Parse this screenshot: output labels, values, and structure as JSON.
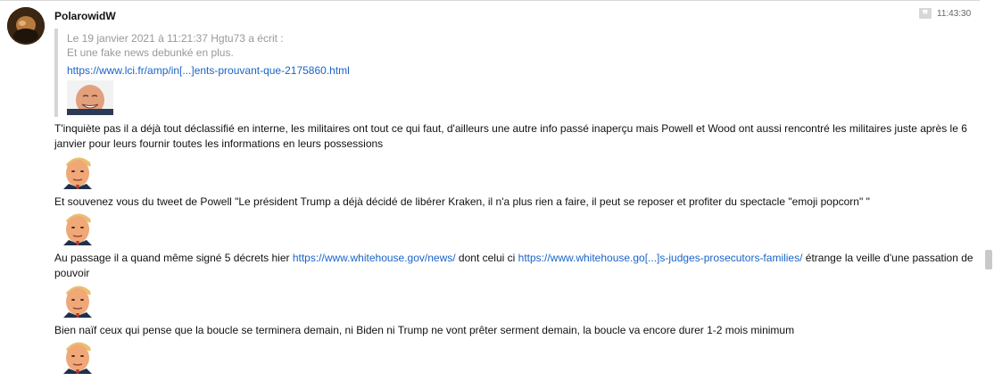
{
  "post": {
    "username": "PolarowidW",
    "timestamp": "11:43:30",
    "quote_icon": "quote-icon",
    "quote": {
      "header": "Le 19 janvier 2021 à 11:21:37 Hgtu73 a écrit :",
      "text": "Et une fake news debunké en plus.",
      "link": "https://www.lci.fr/amp/in[...]ents-prouvant-que-2175860.html",
      "image": "biden-laughing-sticker"
    },
    "paragraphs": {
      "p1": "T'inquiète pas il a déjà tout déclassifié en interne, les militaires ont tout ce qui faut, d'ailleurs une autre info passé inaperçu mais Powell et Wood ont aussi rencontré les militaires juste après le 6 janvier pour leurs fournir toutes les informations en leurs possessions",
      "p2": "Et souvenez vous du tweet de Powell \"Le président Trump a déjà décidé de libérer Kraken, il n'a plus rien a faire, il peut se reposer et profiter du spectacle \"emoji popcorn\" \"",
      "p3_before": "Au passage il a quand même signé 5 décrets hier ",
      "p3_link1": "https://www.whitehouse.gov/news/",
      "p3_mid": " dont celui ci ",
      "p3_link2": "https://www.whitehouse.go[...]s-judges-prosecutors-families/",
      "p3_after": " étrange la veille d'une passation de pouvoir",
      "p4": "Bien naïf ceux qui pense que la boucle se terminera demain, ni Biden ni Trump ne vont prêter serment demain, la boucle va encore durer 1-2 mois minimum"
    },
    "sticker_name": "trump-face-sticker"
  }
}
